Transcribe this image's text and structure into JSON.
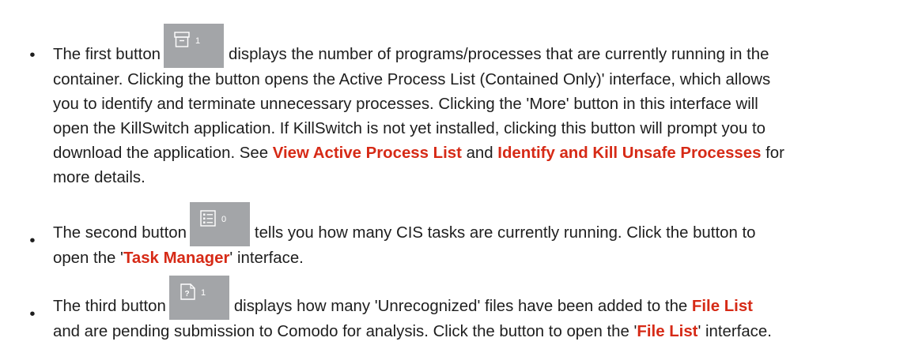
{
  "items": [
    {
      "bullet": "•",
      "line1_before": "The first button",
      "badge": "1",
      "icon": "archive-icon",
      "line1_after": "displays the number of programs/processes that are currently running in the",
      "line2": "container. Clicking the button opens the Active Process List (Contained Only)' interface, which allows",
      "line3": "you to identify and terminate unnecessary processes. Clicking the 'More' button in this interface will",
      "line4": "open the KillSwitch application. If KillSwitch is not yet installed, clicking this button will prompt you to",
      "line5_before": "download the application. See",
      "link1": "View Active Process List",
      "line5_mid": "and",
      "link2": "Identify and Kill Unsafe Processes",
      "line5_after": "for",
      "line6": "more details."
    },
    {
      "bullet": "•",
      "line1_before": "The second button",
      "badge": "0",
      "icon": "task-list-icon",
      "line1_after": "tells you how many CIS tasks are currently running. Click the button to",
      "line2_before": "open the '",
      "link1": "Task Manager",
      "line2_after": "' interface."
    },
    {
      "bullet": "•",
      "line1_before": "The third button",
      "badge": "1",
      "icon": "unknown-file-icon",
      "line1_after": "displays how many 'Unrecognized' files have been added to the",
      "link1": "File List",
      "line2_before": "and are pending submission to Comodo for analysis. Click the button to open the '",
      "link2": "File List",
      "line2_after": "' interface."
    }
  ],
  "colors": {
    "text": "#1e1e1e",
    "link": "#d62a16",
    "button_bg": "#a3a5a8",
    "icon_stroke": "#ffffff"
  }
}
